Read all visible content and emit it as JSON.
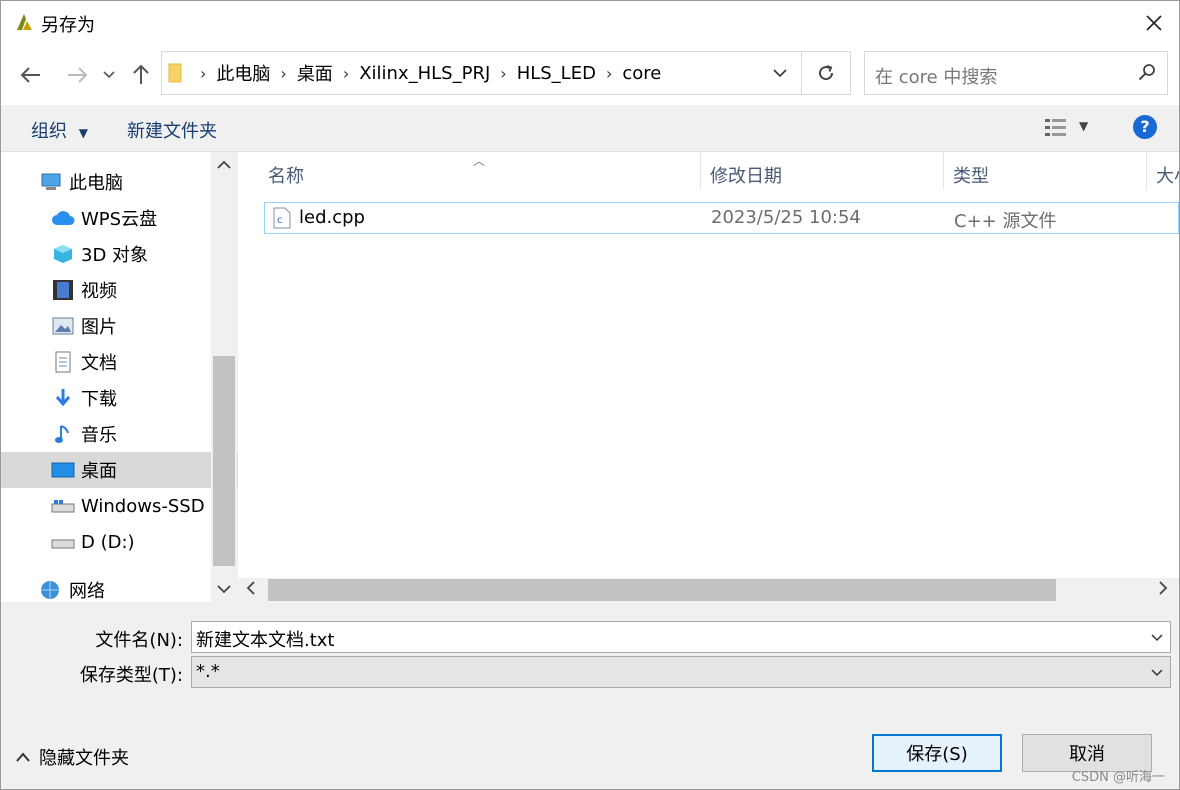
{
  "window": {
    "title": "另存为"
  },
  "address": {
    "crumbs": [
      "此电脑",
      "桌面",
      "Xilinx_HLS_PRJ",
      "HLS_LED",
      "core"
    ]
  },
  "search": {
    "placeholder": "在 core 中搜索"
  },
  "toolbar": {
    "organize": "组织",
    "new_folder": "新建文件夹",
    "help": "?"
  },
  "nav": {
    "items": [
      {
        "label": "此电脑",
        "icon": "computer-icon"
      },
      {
        "label": "WPS云盘",
        "icon": "cloud-icon"
      },
      {
        "label": "3D 对象",
        "icon": "cube-icon"
      },
      {
        "label": "视频",
        "icon": "video-icon"
      },
      {
        "label": "图片",
        "icon": "picture-icon"
      },
      {
        "label": "文档",
        "icon": "document-icon"
      },
      {
        "label": "下载",
        "icon": "download-icon"
      },
      {
        "label": "音乐",
        "icon": "music-icon"
      },
      {
        "label": "桌面",
        "icon": "desktop-icon",
        "selected": true
      },
      {
        "label": "Windows-SSD (",
        "icon": "drive-icon"
      },
      {
        "label": "D (D:)",
        "icon": "drive-icon"
      },
      {
        "label": "网络",
        "icon": "network-icon"
      }
    ]
  },
  "columns": {
    "name": "名称",
    "modified": "修改日期",
    "type": "类型",
    "size": "大小"
  },
  "files": [
    {
      "name": "led.cpp",
      "modified": "2023/5/25 10:54",
      "type": "C++ 源文件",
      "icon": "cpp-file-icon"
    }
  ],
  "form": {
    "filename_label": "文件名(N):",
    "filename_value": "新建文本文档.txt",
    "filetype_label": "保存类型(T):",
    "filetype_value": "*.*"
  },
  "footer": {
    "hide_folders": "隐藏文件夹",
    "save": "保存(S)",
    "cancel": "取消",
    "watermark": "CSDN @听海一"
  },
  "colors": {
    "accent": "#0078d7",
    "link": "#1a3e72",
    "selection": "#99d1ff"
  }
}
